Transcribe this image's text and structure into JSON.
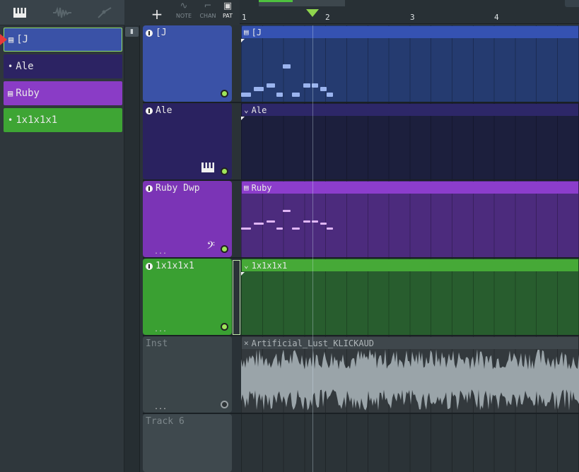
{
  "toolbar": {
    "icons": [
      "piano-icon",
      "waveform-icon",
      "automation-icon"
    ]
  },
  "picker": {
    "items": [
      {
        "glyph": "▤",
        "label": "[J"
      },
      {
        "glyph": "•",
        "label": "Ale"
      },
      {
        "glyph": "▤",
        "label": "Ruby"
      },
      {
        "glyph": "•",
        "label": "1x1x1x1"
      }
    ]
  },
  "header": {
    "add_label": "+",
    "modes": [
      {
        "label": "NOTE"
      },
      {
        "label": "CHAN"
      },
      {
        "label": "PAT"
      }
    ]
  },
  "ruler": {
    "bars": [
      "1",
      "2",
      "3",
      "4"
    ]
  },
  "tracks": [
    {
      "name": "[J",
      "clip": "[J",
      "clip_glyph": "▤",
      "icon": ""
    },
    {
      "name": "Ale",
      "clip": "Ale",
      "clip_glyph": "⌄",
      "icon": "piano-icon"
    },
    {
      "name": "Ruby Dwp",
      "clip": "Ruby",
      "clip_glyph": "▤",
      "icon": "bass-clef-icon"
    },
    {
      "name": "1x1x1x1",
      "clip": "1x1x1x1",
      "clip_glyph": "⌄",
      "icon": ""
    },
    {
      "name": "Inst",
      "clip": "Artificial_Lust_KLICKAUD",
      "clip_glyph": "✕",
      "icon": ""
    },
    {
      "name": "Track 6",
      "clip": "",
      "clip_glyph": "",
      "icon": ""
    }
  ],
  "dots": "...",
  "colors": {
    "accent_green": "#8fd54d",
    "marker_red": "#e83a3a",
    "track1": "#3a52a7",
    "track2": "#2a2260",
    "track3": "#7b34b6",
    "track4": "#3aa032"
  }
}
